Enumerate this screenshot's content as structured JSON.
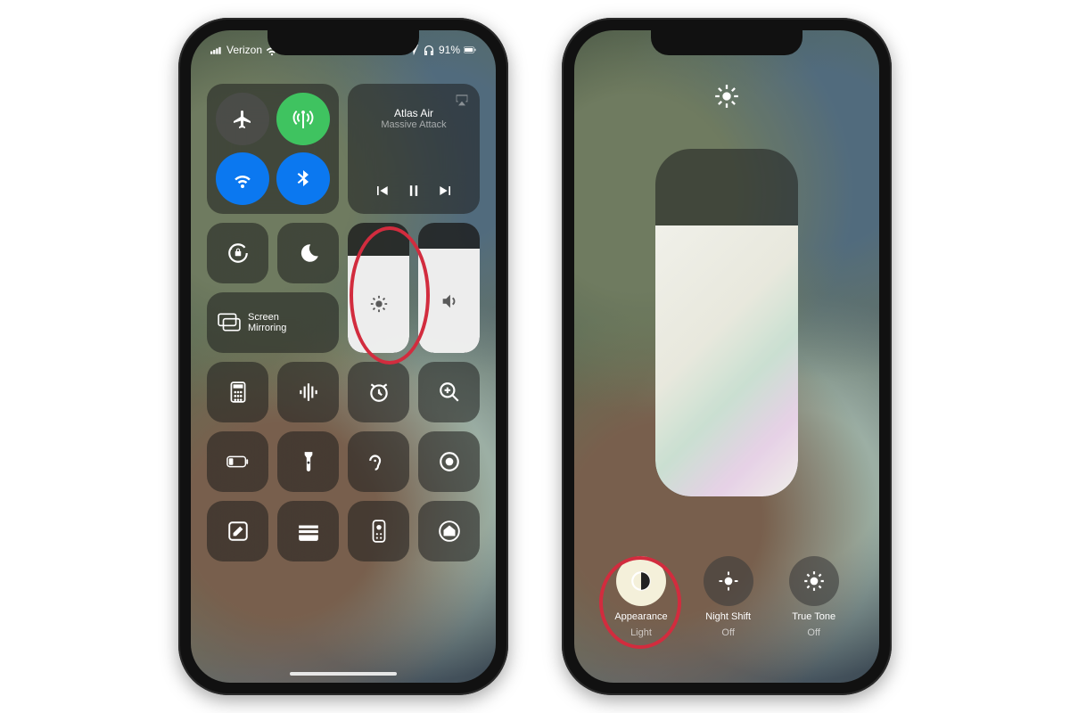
{
  "status": {
    "carrier": "Verizon",
    "battery_pct": "91%"
  },
  "music": {
    "title": "Atlas Air",
    "artist": "Massive Attack"
  },
  "mirror": {
    "line1": "Screen",
    "line2": "Mirroring"
  },
  "brightness_level_pct": 75,
  "volume_level_pct": 80,
  "expanded": {
    "brightness_level_pct": 78,
    "options": [
      {
        "label": "Appearance",
        "value": "Light"
      },
      {
        "label": "Night Shift",
        "value": "Off"
      },
      {
        "label": "True Tone",
        "value": "Off"
      }
    ]
  }
}
